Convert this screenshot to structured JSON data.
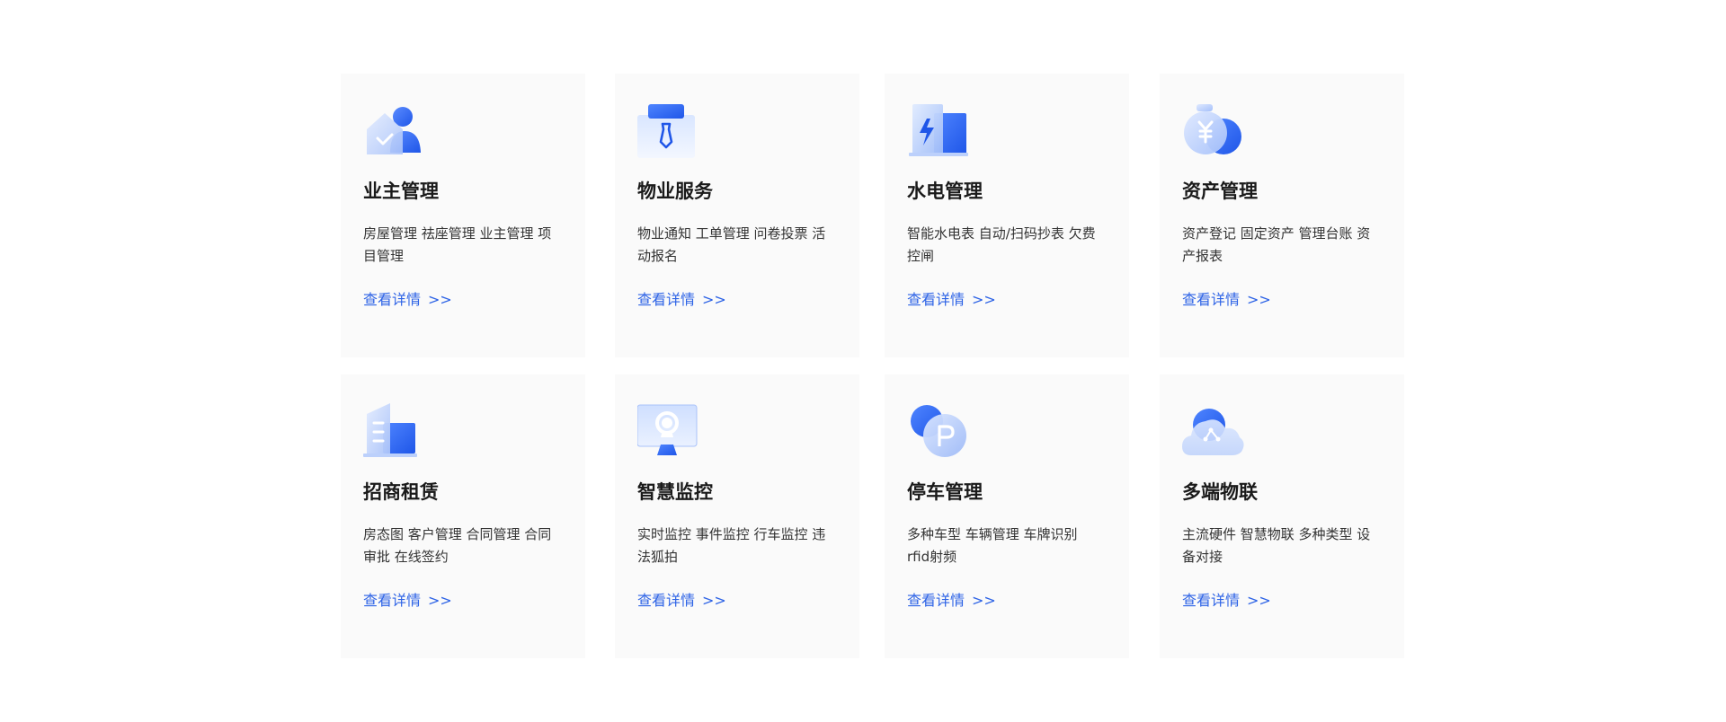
{
  "link_arrow": ">>",
  "cards": [
    {
      "title": "业主管理",
      "desc": "房屋管理 祛座管理 业主管理 项目管理",
      "link": "查看详情",
      "icon": "owner-home-icon"
    },
    {
      "title": "物业服务",
      "desc": "物业通知 工单管理 问卷投票 活动报名",
      "link": "查看详情",
      "icon": "staff-tie-icon"
    },
    {
      "title": "水电管理",
      "desc": "智能水电表 自动/扫码抄表 欠费控闸",
      "link": "查看详情",
      "icon": "utility-building-icon"
    },
    {
      "title": "资产管理",
      "desc": "资产登记 固定资产 管理台账 资产报表",
      "link": "查看详情",
      "icon": "money-bag-icon"
    },
    {
      "title": "招商租赁",
      "desc": "房态图 客户管理 合同管理 合同审批 在线签约",
      "link": "查看详情",
      "icon": "office-building-icon"
    },
    {
      "title": "智慧监控",
      "desc": "实时监控 事件监控 行车监控 违法狐拍",
      "link": "查看详情",
      "icon": "monitor-camera-icon"
    },
    {
      "title": "停车管理",
      "desc": "多种车型 车辆管理 车牌识别 rfid射频",
      "link": "查看详情",
      "icon": "parking-icon"
    },
    {
      "title": "多端物联",
      "desc": "主流硬件 智慧物联 多种类型 设备对接",
      "link": "查看详情",
      "icon": "cloud-share-icon"
    }
  ],
  "colors": {
    "accent": "#2d63e6",
    "card_bg": "#fafafa",
    "title": "#1a1a1a",
    "text": "#333333"
  }
}
